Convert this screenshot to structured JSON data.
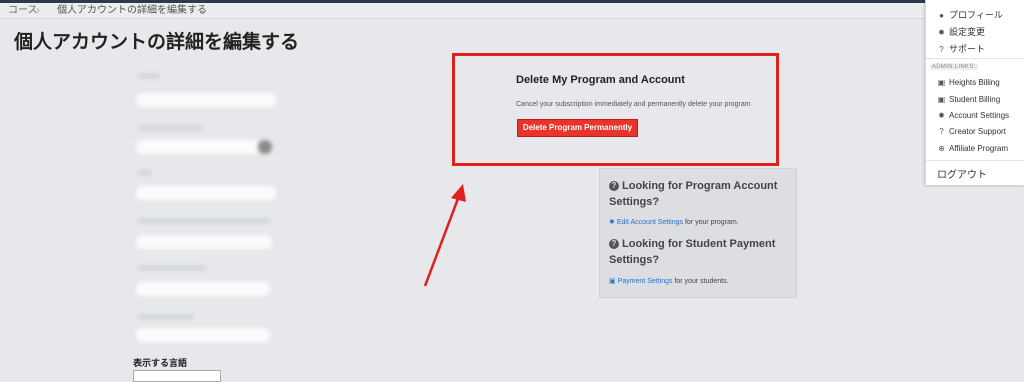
{
  "breadcrumb": {
    "items": [
      "コース",
      "個人アカウントの詳細を編集する"
    ]
  },
  "page": {
    "title": "個人アカウントの詳細を編集する"
  },
  "form": {
    "language_label": "表示する言語"
  },
  "delete_section": {
    "title": "Delete My Program and Account",
    "description": "Cancel your subscription immediately and permanently delete your program",
    "button_label": "Delete Program Permanently",
    "highlight_color": "#e02020"
  },
  "help_panel": {
    "program_heading": "Looking for Program Account Settings?",
    "program_link": "Edit Account Settings",
    "program_suffix": " for your program.",
    "student_heading": "Looking for Student Payment Settings?",
    "student_link": "Payment Settings",
    "student_suffix": " for your students."
  },
  "user_menu": {
    "profile": "プロフィール",
    "settings": "設定変更",
    "support": "サポート",
    "admin_links_label": "ADMIN LINKS:",
    "admin_items": [
      {
        "label": "Heights Billing",
        "icon": "money-icon"
      },
      {
        "label": "Student Billing",
        "icon": "money-icon"
      },
      {
        "label": "Account Settings",
        "icon": "gear-icon"
      },
      {
        "label": "Creator Support",
        "icon": "question-icon"
      },
      {
        "label": "Affiliate Program",
        "icon": "plus-circle-icon"
      }
    ],
    "logout": "ログアウト"
  }
}
